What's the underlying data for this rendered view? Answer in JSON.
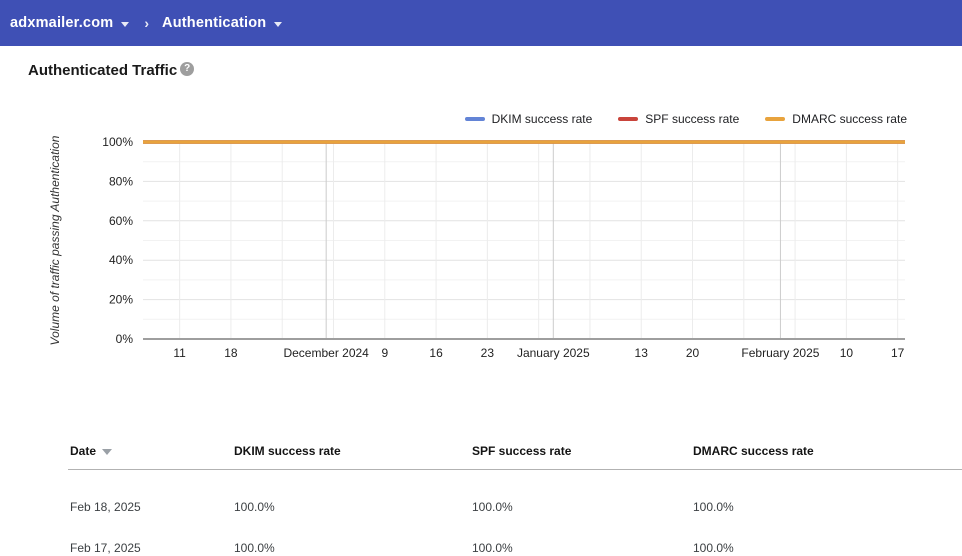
{
  "topbar": {
    "domain": "adxmailer.com",
    "separator": "›",
    "section": "Authentication"
  },
  "page": {
    "title": "Authenticated Traffic",
    "help_glyph": "?"
  },
  "chart_data": {
    "type": "line",
    "title": "Authenticated Traffic",
    "ylabel": "Volume of traffic passing Authentication",
    "ylim": [
      0,
      100
    ],
    "grid": true,
    "legend_position": "top-right",
    "y_ticks": [
      {
        "value": 0,
        "label": "0%"
      },
      {
        "value": 20,
        "label": "20%"
      },
      {
        "value": 40,
        "label": "40%"
      },
      {
        "value": 60,
        "label": "60%"
      },
      {
        "value": 80,
        "label": "80%"
      },
      {
        "value": 100,
        "label": "100%"
      }
    ],
    "y_minor_step": 10,
    "x_domain": [
      "2024-11-06",
      "2025-02-18"
    ],
    "x_week_gridlines": [
      "2024-11-11",
      "2024-11-18",
      "2024-11-25",
      "2024-12-02",
      "2024-12-09",
      "2024-12-16",
      "2024-12-23",
      "2024-12-30",
      "2025-01-06",
      "2025-01-13",
      "2025-01-20",
      "2025-01-27",
      "2025-02-03",
      "2025-02-10",
      "2025-02-17"
    ],
    "x_week_labels": [
      {
        "date": "2024-11-11",
        "label": "11"
      },
      {
        "date": "2024-11-18",
        "label": "18"
      },
      {
        "date": "2024-12-09",
        "label": "9"
      },
      {
        "date": "2024-12-16",
        "label": "16"
      },
      {
        "date": "2024-12-23",
        "label": "23"
      },
      {
        "date": "2025-01-13",
        "label": "13"
      },
      {
        "date": "2025-01-20",
        "label": "20"
      },
      {
        "date": "2025-02-10",
        "label": "10"
      },
      {
        "date": "2025-02-17",
        "label": "17"
      }
    ],
    "x_month_ticks": [
      {
        "date": "2024-12-01",
        "label": "December 2024"
      },
      {
        "date": "2025-01-01",
        "label": "January 2025"
      },
      {
        "date": "2025-02-01",
        "label": "February 2025"
      }
    ],
    "series": [
      {
        "name": "DKIM success rate",
        "color": "#6384d6",
        "value_percent": 100
      },
      {
        "name": "SPF success rate",
        "color": "#c9443b",
        "value_percent": 100
      },
      {
        "name": "DMARC success rate",
        "color": "#e8a33d",
        "value_percent": 100
      }
    ]
  },
  "table": {
    "columns": [
      {
        "label": "Date",
        "sorted": "descending"
      },
      {
        "label": "DKIM success rate"
      },
      {
        "label": "SPF success rate"
      },
      {
        "label": "DMARC success rate"
      }
    ],
    "rows": [
      {
        "date": "Feb 18, 2025",
        "dkim": "100.0%",
        "spf": "100.0%",
        "dmarc": "100.0%"
      },
      {
        "date": "Feb 17, 2025",
        "dkim": "100.0%",
        "spf": "100.0%",
        "dmarc": "100.0%"
      }
    ]
  },
  "colors": {
    "topbar_background": "#3f50b5",
    "baseline_axis": "#9e9e9e",
    "dkim_line": "#6384d6",
    "spf_line": "#c9443b",
    "dmarc_line": "#e8a33d"
  }
}
